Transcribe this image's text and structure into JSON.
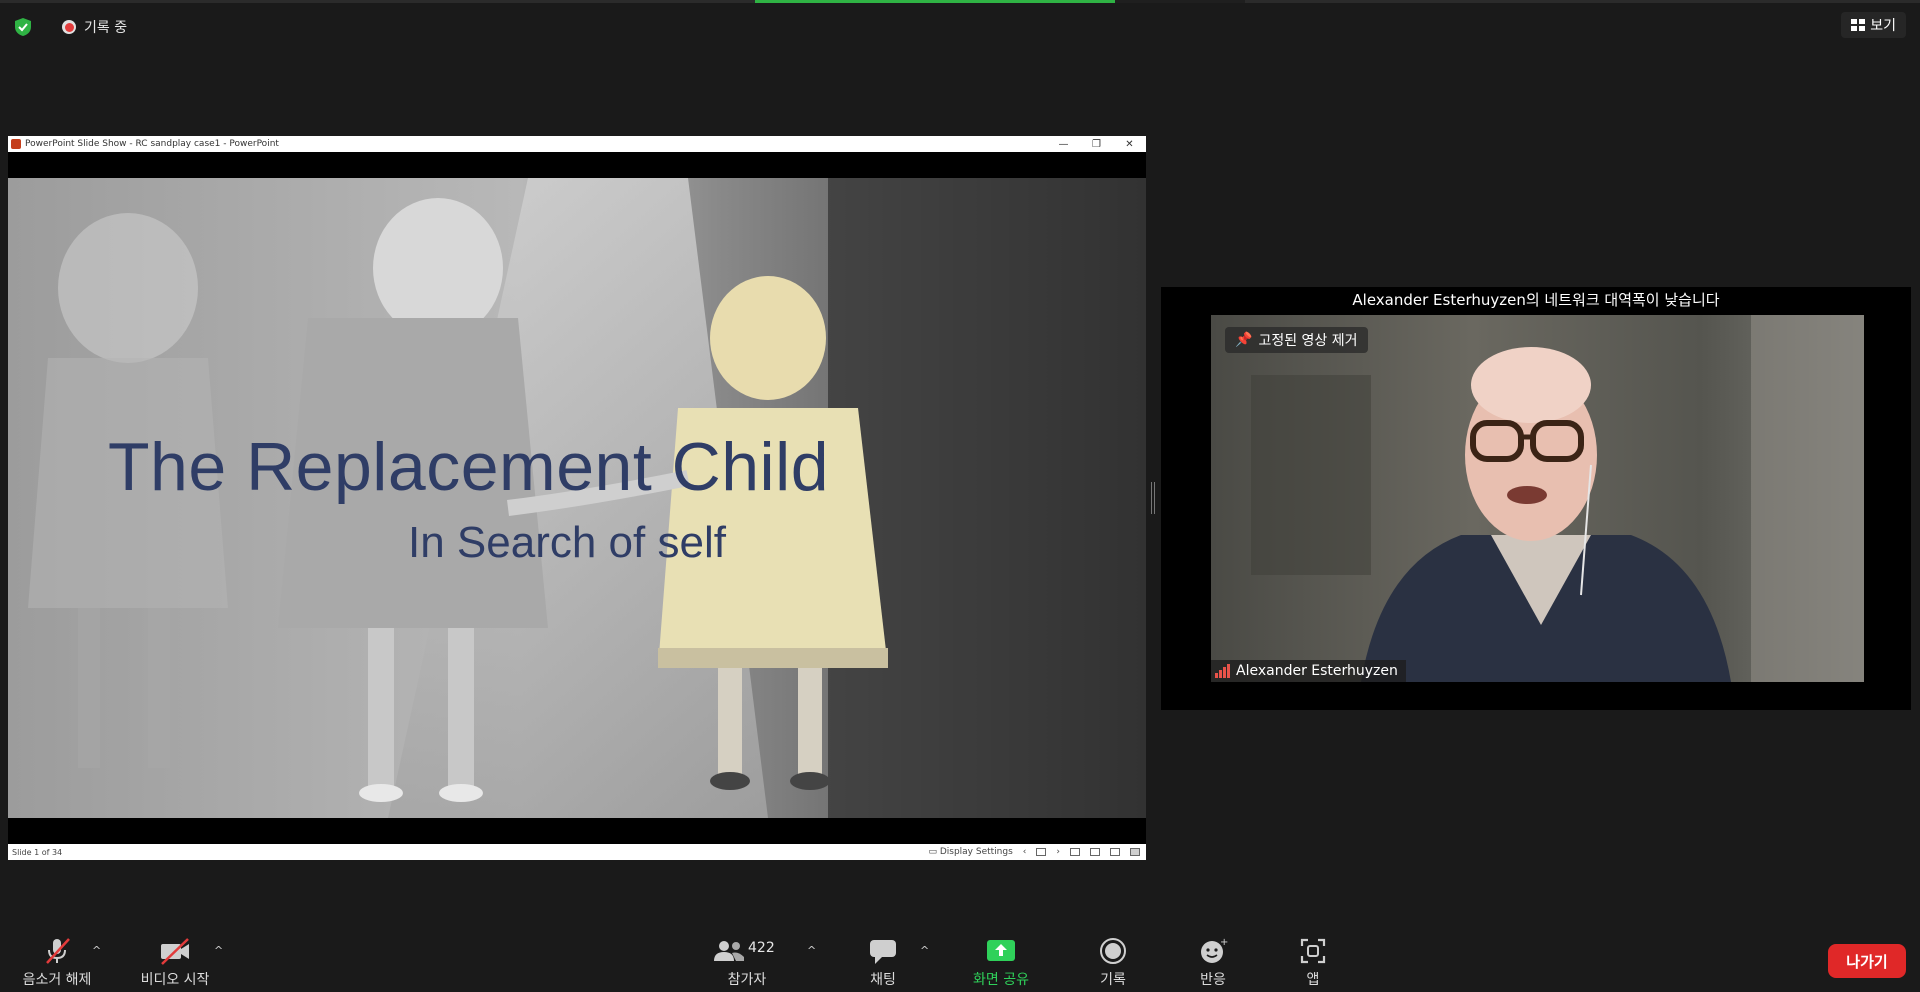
{
  "topbar": {
    "recording_label": "기록 중",
    "view_label": "보기"
  },
  "ppt": {
    "window_title": "PowerPoint Slide Show  -  RC sandplay case1  -  PowerPoint",
    "slide_title": "The Replacement Child",
    "slide_subtitle": "In Search of self",
    "status_slide": "Slide 1 of 34",
    "display_settings": "Display Settings"
  },
  "video": {
    "network_warning": "Alexander Esterhuyzen의 네트워크 대역폭이 낮습니다",
    "unpin_label": "고정된 영상 제거",
    "participant_name": "Alexander Esterhuyzen"
  },
  "toolbar": {
    "mute_label": "음소거 해제",
    "video_label": "비디오 시작",
    "participants_label": "참가자",
    "participants_count": "422",
    "chat_label": "채팅",
    "share_label": "화면 공유",
    "record_label": "기록",
    "reactions_label": "반응",
    "apps_label": "앱",
    "leave_label": "나가기"
  },
  "colors": {
    "background": "#1a1a1a",
    "share_green": "#2fd15a",
    "leave_red": "#e02828",
    "slide_text": "#2f3d66"
  }
}
